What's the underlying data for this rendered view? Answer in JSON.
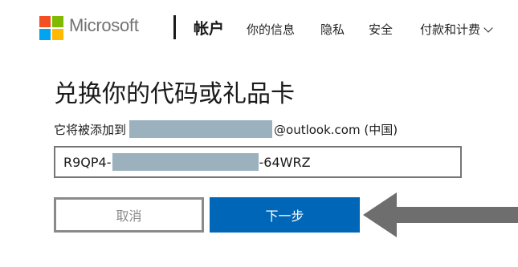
{
  "header": {
    "brand": "Microsoft",
    "section": "帐户",
    "nav": [
      {
        "label": "你的信息"
      },
      {
        "label": "隐私"
      },
      {
        "label": "安全"
      },
      {
        "label": "付款和计费"
      }
    ]
  },
  "main": {
    "title": "兑换你的代码或礼品卡",
    "added_prefix": "它将被添加到",
    "email_suffix": "@outlook.com (中国)",
    "code_prefix": "R9QP4-",
    "code_suffix": "-64WRZ"
  },
  "buttons": {
    "cancel": "取消",
    "next": "下一步"
  },
  "colors": {
    "accent": "#0067b8",
    "redaction": "#9cb1be",
    "arrow": "#6e6e6e"
  }
}
